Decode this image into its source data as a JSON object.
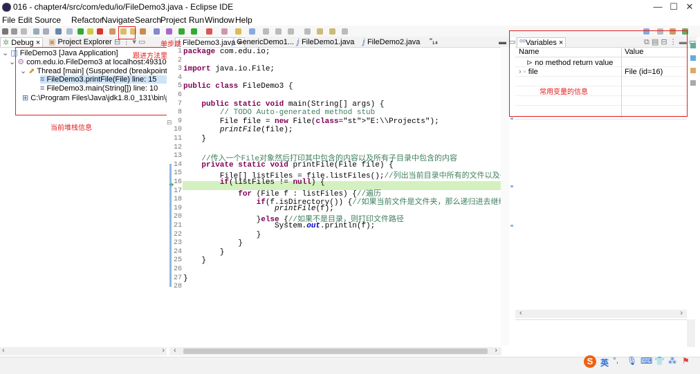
{
  "window": {
    "title": "016 - chapter4/src/com/edu/io/FileDemo3.java - Eclipse IDE",
    "minimize": "—",
    "maximize": "☐",
    "close": "✕"
  },
  "menu": [
    "File",
    "Edit",
    "Source",
    "Refactor",
    "Navigate",
    "Search",
    "Project",
    "Run",
    "Window",
    "Help"
  ],
  "left_tabs": {
    "debug": "Debug",
    "project_explorer": "Project Explorer"
  },
  "debug_tree": [
    "FileDemo3 [Java Application]",
    "com.edu.io.FileDemo3 at localhost:49310",
    "Thread [main] (Suspended (breakpoint",
    "FileDemo3.printFile(File) line: 15",
    "FileDemo3.main(String[]) line: 10",
    "C:\\Program Files\\Java\\jdk1.8.0_131\\bin\\ja"
  ],
  "editor_tabs": [
    "FileDemo3.java",
    "GenericDemo1...",
    "FileDemo1.java",
    "FileDemo2.java",
    "\"₁₄"
  ],
  "annotations": {
    "step_into": "单步跳",
    "step_into_method": "跟进方法里面",
    "stack_info": "当前堆栈信息",
    "variables_info": "常用变量的信息"
  },
  "code": [
    {
      "n": "1",
      "t": "package com.edu.io;"
    },
    {
      "n": "2",
      "t": ""
    },
    {
      "n": "3",
      "t": "import java.io.File;"
    },
    {
      "n": "4",
      "t": ""
    },
    {
      "n": "5",
      "t": "public class FileDemo3 {"
    },
    {
      "n": "6",
      "t": ""
    },
    {
      "n": "7",
      "t": "    public static void main(String[] args) {"
    },
    {
      "n": "8",
      "t": "        // TODO Auto-generated method stub"
    },
    {
      "n": "9",
      "t": "        File file = new File(\"E:\\\\Projects\");"
    },
    {
      "n": "10",
      "t": "        printFile(file);"
    },
    {
      "n": "11",
      "t": "    }"
    },
    {
      "n": "12",
      "t": ""
    },
    {
      "n": "13",
      "t": "    //传入一个File对象然后打印其中包含的内容以及所有子目录中包含的内容"
    },
    {
      "n": "14",
      "t": "    private static void printFile(File file) {"
    },
    {
      "n": "15",
      "t": "        File[] listFiles = file.listFiles();//列出当前目录中所有的文件以及子"
    },
    {
      "n": "16",
      "t": "        if(listFiles != null) {"
    },
    {
      "n": "17",
      "t": "            for (File f : listFiles) {//遍历"
    },
    {
      "n": "18",
      "t": "                if(f.isDirectory()) {//如果当前文件是文件夹，那么递归进去继续"
    },
    {
      "n": "19",
      "t": "                    printFile(f);"
    },
    {
      "n": "20",
      "t": "                }else {//如果不是目录，则打印文件路径"
    },
    {
      "n": "21",
      "t": "                    System.out.println(f);"
    },
    {
      "n": "22",
      "t": "                }"
    },
    {
      "n": "23",
      "t": "            }"
    },
    {
      "n": "24",
      "t": "        }"
    },
    {
      "n": "25",
      "t": "    }"
    },
    {
      "n": "26",
      "t": ""
    },
    {
      "n": "27",
      "t": "}"
    },
    {
      "n": "28",
      "t": ""
    }
  ],
  "variables": {
    "tab": "Variables",
    "col_name": "Name",
    "col_value": "Value",
    "rows": [
      {
        "name": "no method return value",
        "value": ""
      },
      {
        "name": "file",
        "value": "File (id=16)"
      }
    ]
  },
  "ime": {
    "lang": "英"
  },
  "colors": {
    "annotation_red": "#e02020",
    "current_line": "#d4f0c0",
    "keyword": "#7f0055"
  }
}
